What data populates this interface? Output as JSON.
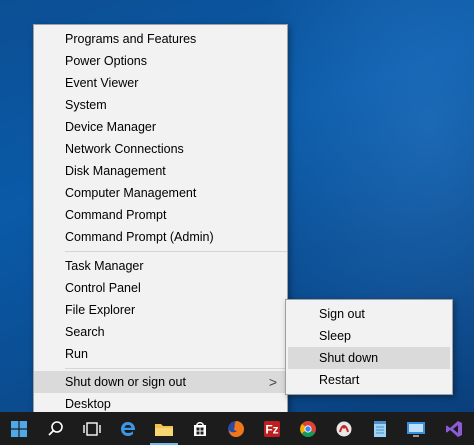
{
  "menu": {
    "items": [
      {
        "label": "Programs and Features"
      },
      {
        "label": "Power Options"
      },
      {
        "label": "Event Viewer"
      },
      {
        "label": "System"
      },
      {
        "label": "Device Manager"
      },
      {
        "label": "Network Connections"
      },
      {
        "label": "Disk Management"
      },
      {
        "label": "Computer Management"
      },
      {
        "label": "Command Prompt"
      },
      {
        "label": "Command Prompt (Admin)"
      },
      {
        "label": "Task Manager"
      },
      {
        "label": "Control Panel"
      },
      {
        "label": "File Explorer"
      },
      {
        "label": "Search"
      },
      {
        "label": "Run"
      },
      {
        "label": "Shut down or sign out",
        "arrow": ">"
      },
      {
        "label": "Desktop"
      }
    ]
  },
  "submenu": {
    "items": [
      {
        "label": "Sign out"
      },
      {
        "label": "Sleep"
      },
      {
        "label": "Shut down"
      },
      {
        "label": "Restart"
      }
    ]
  },
  "taskbar": {
    "icons": [
      "windows-start-icon",
      "search-icon",
      "task-view-icon",
      "edge-icon",
      "file-explorer-icon",
      "store-icon",
      "firefox-icon",
      "filezilla-icon",
      "chrome-icon",
      "pdf-tool-icon",
      "notepad-icon",
      "remote-desktop-icon",
      "visual-studio-icon"
    ]
  },
  "colors": {
    "desktop": "#0b57a4",
    "menu_bg": "#f2f2f2",
    "highlight": "#dadada",
    "taskbar": "#1c1c1c",
    "accent": "#76b9ed"
  }
}
